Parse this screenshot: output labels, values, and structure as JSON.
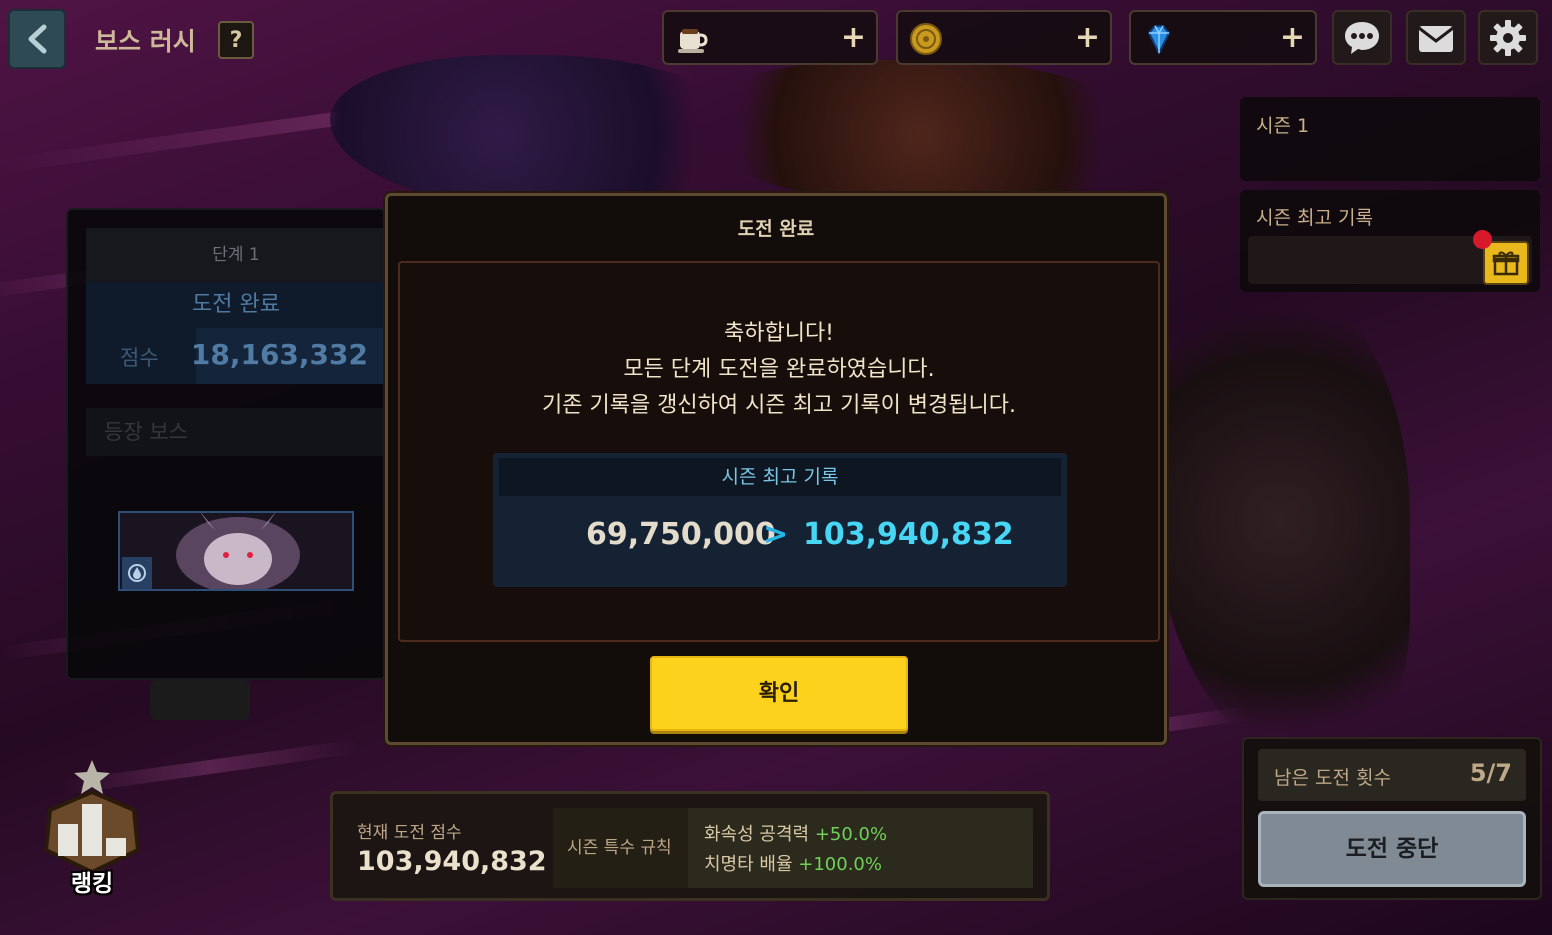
{
  "header": {
    "title": "보스 러시",
    "help_label": "?"
  },
  "currencies": [
    {
      "icon": "coffee-cup-icon",
      "plus": "+"
    },
    {
      "icon": "gold-coin-icon",
      "plus": "+"
    },
    {
      "icon": "diamond-gem-icon",
      "plus": "+"
    }
  ],
  "top_icons": [
    "chat-icon",
    "mail-icon",
    "gear-icon"
  ],
  "season": {
    "label": "시즌 1",
    "best_label": "시즌 최고 기록"
  },
  "stage": {
    "title": "단계 1",
    "status": "도전 완료",
    "score_label": "점수",
    "score_value": "18,163,332",
    "boss_label": "등장 보스"
  },
  "modal": {
    "title": "도전 완료",
    "line1": "축하합니다!",
    "line2": "모든 단계 도전을 완료하였습니다.",
    "line3": "기존 기록을 갱신하여 시즌 최고 기록이 변경됩니다.",
    "record_label": "시즌 최고 기록",
    "old_record": "69,750,000",
    "arrow": ">",
    "new_record": "103,940,832",
    "confirm_label": "확인"
  },
  "bottom": {
    "current_label": "현재 도전 점수",
    "current_score": "103,940,832",
    "rule_label": "시즌 특수 규칙",
    "rules": [
      {
        "text": "화속성 공격력",
        "bonus": "+50.0%"
      },
      {
        "text": "치명타 배율",
        "bonus": "+100.0%"
      }
    ]
  },
  "right_bottom": {
    "remaining_label": "남은 도전 횟수",
    "remaining_value": "5/7",
    "stop_label": "도전 중단"
  },
  "ranking": {
    "label": "랭킹"
  },
  "colors": {
    "confirm_button": "#fdd21c",
    "new_record": "#47d6f4",
    "bonus": "#6fd05a",
    "notification_dot": "#d8192c"
  }
}
